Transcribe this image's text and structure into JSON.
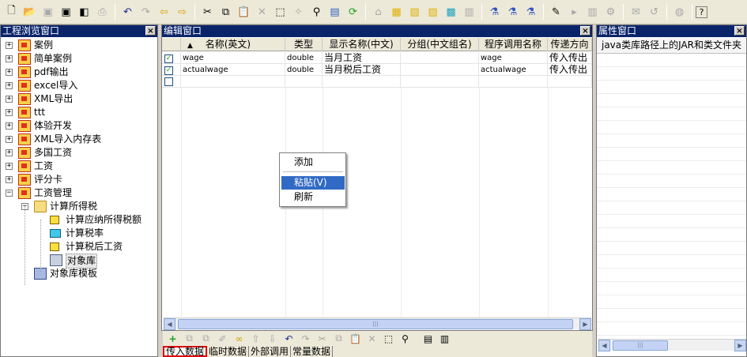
{
  "toolbar": {
    "buttons": [
      "new-icon",
      "open-icon",
      "save-icon",
      "save-disabled-icon",
      "save-all-icon",
      "print-icon",
      "undo-icon",
      "redo-icon",
      "back-icon",
      "forward-icon",
      "cut-icon",
      "copy-icon",
      "paste-icon",
      "delete-icon",
      "select-icon",
      "wand-icon",
      "find-icon",
      "export-icon",
      "refresh-icon",
      "module-icon",
      "add-package-icon",
      "open-package-icon",
      "package-prop-icon",
      "package-link-icon",
      "package-move-icon",
      "run-icon",
      "debug-icon",
      "step-icon",
      "edit-icon",
      "play-icon",
      "build-icon",
      "build2-icon",
      "mail-icon",
      "undo2-icon",
      "globe-icon",
      "help-icon"
    ]
  },
  "project_panel": {
    "title": "工程浏览窗口",
    "tree": [
      {
        "label": "案例",
        "level": 0,
        "expanded": false,
        "icon": "project-icon"
      },
      {
        "label": "简单案例",
        "level": 0,
        "expanded": false,
        "icon": "project-icon"
      },
      {
        "label": "pdf输出",
        "level": 0,
        "expanded": false,
        "icon": "project-icon"
      },
      {
        "label": "excel导入",
        "level": 0,
        "expanded": false,
        "icon": "project-icon"
      },
      {
        "label": "XML导出",
        "level": 0,
        "expanded": false,
        "icon": "project-icon"
      },
      {
        "label": "ttt",
        "level": 0,
        "expanded": false,
        "icon": "project-icon"
      },
      {
        "label": "体验开发",
        "level": 0,
        "expanded": false,
        "icon": "project-icon"
      },
      {
        "label": "XML导入内存表",
        "level": 0,
        "expanded": false,
        "icon": "project-icon"
      },
      {
        "label": "多国工资",
        "level": 0,
        "expanded": false,
        "icon": "project-icon"
      },
      {
        "label": "工资",
        "level": 0,
        "expanded": false,
        "icon": "project-icon"
      },
      {
        "label": "评分卡",
        "level": 0,
        "expanded": false,
        "icon": "project-icon"
      },
      {
        "label": "工资管理",
        "level": 0,
        "expanded": true,
        "icon": "project-icon"
      },
      {
        "label": "计算所得税",
        "level": 1,
        "expanded": true,
        "icon": "folder-icon"
      },
      {
        "label": "计算应纳所得税额",
        "level": 2,
        "icon": "function-icon"
      },
      {
        "label": "计算税率",
        "level": 2,
        "icon": "rate-table-icon"
      },
      {
        "label": "计算税后工资",
        "level": 2,
        "icon": "function-icon"
      },
      {
        "label": "对象库",
        "level": 2,
        "icon": "object-library-icon",
        "selected": true
      },
      {
        "label": "对象库模板",
        "level": 1,
        "icon": "object-template-icon"
      }
    ]
  },
  "editor_panel": {
    "title": "编辑窗口",
    "sort_indicator": "▲",
    "columns": [
      "名称(英文)",
      "类型",
      "显示名称(中文)",
      "分组(中文组名)",
      "程序调用名称",
      "传递方向"
    ],
    "rows": [
      {
        "checked": true,
        "name": "wage",
        "type": "double",
        "display": "当月工资",
        "group": "",
        "call_name": "wage",
        "direction": "传入传出"
      },
      {
        "checked": true,
        "name": "actualwage",
        "type": "double",
        "display": "当月税后工资",
        "group": "",
        "call_name": "actualwage",
        "direction": "传入传出"
      },
      {
        "checked": false,
        "name": "",
        "type": "",
        "display": "",
        "group": "",
        "call_name": "",
        "direction": ""
      }
    ],
    "bottom_toolbar": [
      "add-icon",
      "add-group-icon",
      "copy-field-icon",
      "pin-icon",
      "link-icon",
      "move-up-icon",
      "move-down-icon",
      "undo-icon",
      "redo-icon",
      "cut-icon",
      "copy-icon",
      "paste-icon",
      "delete-icon",
      "select-icon",
      "find-icon",
      "import-icon",
      "export-icon"
    ],
    "tabs": [
      "传入数据",
      "临时数据",
      "外部调用",
      "常量数据"
    ],
    "active_tab": 0
  },
  "context_menu": {
    "items": [
      "添加",
      "粘贴(V)",
      "刷新"
    ],
    "highlighted": 1
  },
  "property_panel": {
    "title": "属性窗口",
    "header": "java类库路径上的JAR和类文件夹"
  }
}
